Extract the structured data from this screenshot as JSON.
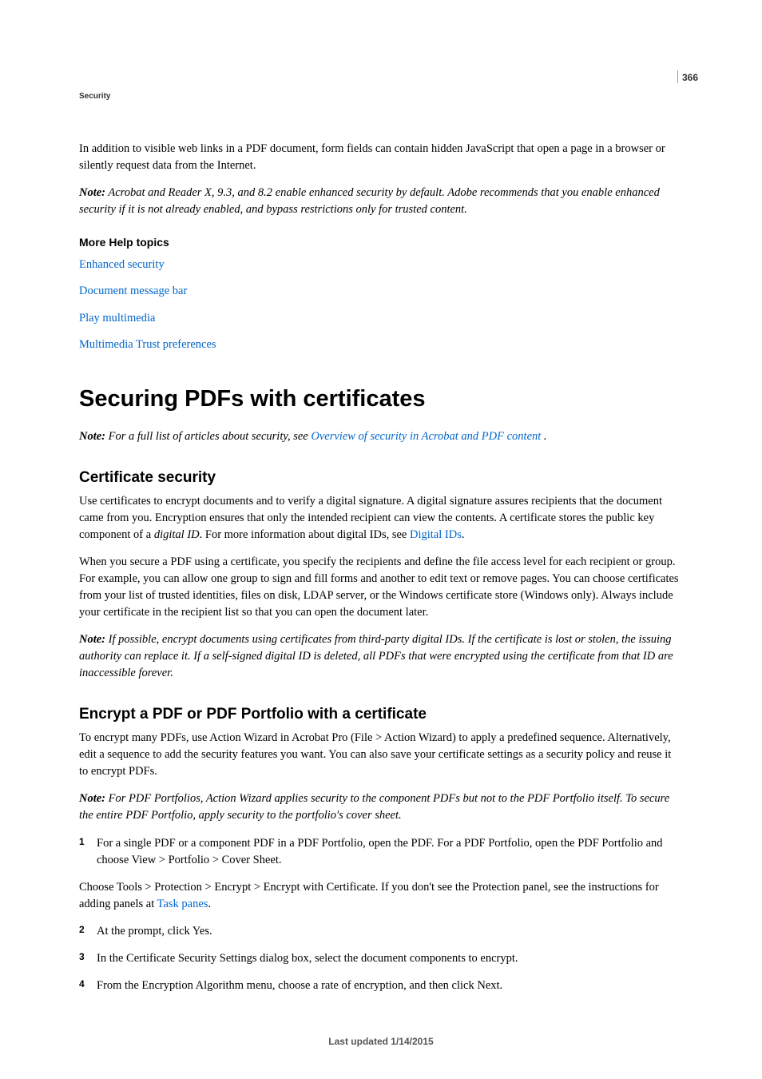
{
  "page_number": "366",
  "section_label": "Security",
  "intro": {
    "p1": "In addition to visible web links in a PDF document, form fields can contain hidden JavaScript that open a page in a browser or silently request data from the Internet.",
    "note_label": "Note:",
    "note_text": " Acrobat and Reader X, 9.3, and 8.2 enable enhanced security by default. Adobe recommends that you enable enhanced security if it is not already enabled, and bypass restrictions only for trusted content."
  },
  "help_topics": {
    "heading": "More Help topics",
    "links": [
      "Enhanced security",
      "Document message bar",
      "Play multimedia",
      "Multimedia Trust preferences"
    ]
  },
  "main_heading": "Securing PDFs with certificates",
  "main_note": {
    "label": "Note:",
    "pre": " For a full list of articles about security, see ",
    "link": "Overview of security in Acrobat and PDF content",
    "post": " ."
  },
  "cert_security": {
    "heading": "Certificate security",
    "p1_pre": "Use certificates to encrypt documents and to verify a digital signature. A digital signature assures recipients that the document came from you. Encryption ensures that only the intended recipient can view the contents. A certificate stores the public key component of a ",
    "p1_term": "digital ID",
    "p1_mid": ". For more information about digital IDs, see ",
    "p1_link": "Digital IDs",
    "p1_post": ".",
    "p2": "When you secure a PDF using a certificate, you specify the recipients and define the file access level for each recipient or group. For example, you can allow one group to sign and fill forms and another to edit text or remove pages. You can choose certificates from your list of trusted identities, files on disk, LDAP server, or the Windows certificate store (Windows only). Always include your certificate in the recipient list so that you can open the document later.",
    "note_label": "Note:",
    "note_text": " If possible, encrypt documents using certificates from third-party digital IDs. If the certificate is lost or stolen, the issuing authority can replace it. If a self-signed digital ID is deleted, all PDFs that were encrypted using the certificate from that ID are inaccessible forever."
  },
  "encrypt": {
    "heading": "Encrypt a PDF or PDF Portfolio with a certificate",
    "p1": "To encrypt many PDFs, use Action Wizard in Acrobat Pro (File > Action Wizard) to apply a predefined sequence. Alternatively, edit a sequence to add the security features you want. You can also save your certificate settings as a security policy and reuse it to encrypt PDFs.",
    "note_label": "Note:",
    "note_text": " For PDF Portfolios, Action Wizard applies security to the component PDFs but not to the PDF Portfolio itself. To secure the entire PDF Portfolio, apply security to the portfolio's cover sheet.",
    "step1": "For a single PDF or a component PDF in a PDF Portfolio, open the PDF. For a PDF Portfolio, open the PDF Portfolio and choose View > Portfolio > Cover Sheet.",
    "nonstep_pre": "Choose Tools > Protection > Encrypt > Encrypt with Certificate. If you don't see the Protection panel, see the instructions for adding panels at ",
    "nonstep_link": "Task panes",
    "nonstep_post": ".",
    "step2": "At the prompt, click Yes.",
    "step3": "In the Certificate Security Settings dialog box, select the document components to encrypt.",
    "step4": "From the Encryption Algorithm menu, choose a rate of encryption, and then click Next."
  },
  "footer": "Last updated 1/14/2015"
}
